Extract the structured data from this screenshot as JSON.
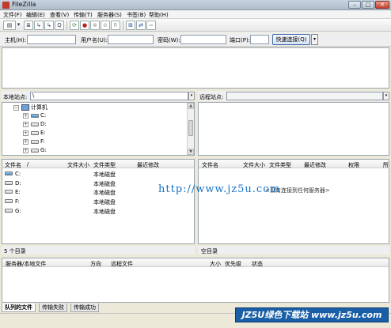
{
  "window": {
    "title": "FileZilla",
    "min_icon": "minimize-icon",
    "max_icon": "maximize-icon",
    "close_icon": "close-icon"
  },
  "menu": [
    "文件(F)",
    "编辑(E)",
    "查看(V)",
    "传输(T)",
    "服务器(S)",
    "书签(B)",
    "帮助(H)"
  ],
  "toolbar_icons": [
    "site-manager-icon",
    "toggle-log-icon",
    "toggle-local-tree-icon",
    "toggle-remote-tree-icon",
    "toggle-queue-icon",
    "refresh-icon",
    "process-queue-icon",
    "cancel-icon",
    "disconnect-icon",
    "reconnect-icon",
    "directory-listing-filter-icon",
    "sync-browsing-icon",
    "compare-icon"
  ],
  "quickconnect": {
    "host_label": "主机(H):",
    "user_label": "用户名(U):",
    "pass_label": "密码(W):",
    "port_label": "端口(P):",
    "host_value": "",
    "user_value": "",
    "pass_value": "",
    "port_value": "",
    "button_label": "快速连接(Q)",
    "dropdown_glyph": "▾"
  },
  "local_site": {
    "label": "本地站点:",
    "path": "\\",
    "drop_glyph": "▾"
  },
  "remote_site": {
    "label": "远程站点:",
    "path": "",
    "drop_glyph": "▾"
  },
  "local_tree": {
    "root": "计算机",
    "drives": [
      "C:",
      "D:",
      "E:",
      "F:",
      "G:"
    ]
  },
  "local_files": {
    "columns": [
      "文件名",
      "/",
      "文件大小",
      "文件类型",
      "最近修改"
    ],
    "rows": [
      {
        "name": "C:",
        "type": "本地磁盘",
        "icon": "system-drive-icon"
      },
      {
        "name": "D:",
        "type": "本地磁盘",
        "icon": "drive-icon"
      },
      {
        "name": "E:",
        "type": "本地磁盘",
        "icon": "drive-icon"
      },
      {
        "name": "F:",
        "type": "本地磁盘",
        "icon": "drive-icon"
      },
      {
        "name": "G:",
        "type": "本地磁盘",
        "icon": "drive-icon"
      }
    ],
    "status": "5 个目录"
  },
  "remote_files": {
    "columns": [
      "文件名",
      "文件大小",
      "文件类型",
      "最近修改",
      "权限",
      "所"
    ],
    "empty_message": "<没有连接到任何服务器>",
    "status": "空目录"
  },
  "queue": {
    "columns": [
      "服务器/本地文件",
      "方向",
      "远程文件",
      "大小",
      "优先级",
      "状态"
    ]
  },
  "tabs": [
    "队列的文件",
    "传输失败",
    "传输成功"
  ],
  "watermark": {
    "url": "http://www.jz5u.com",
    "logo": "JZ5U绿色下载站 www.jz5u.com"
  }
}
